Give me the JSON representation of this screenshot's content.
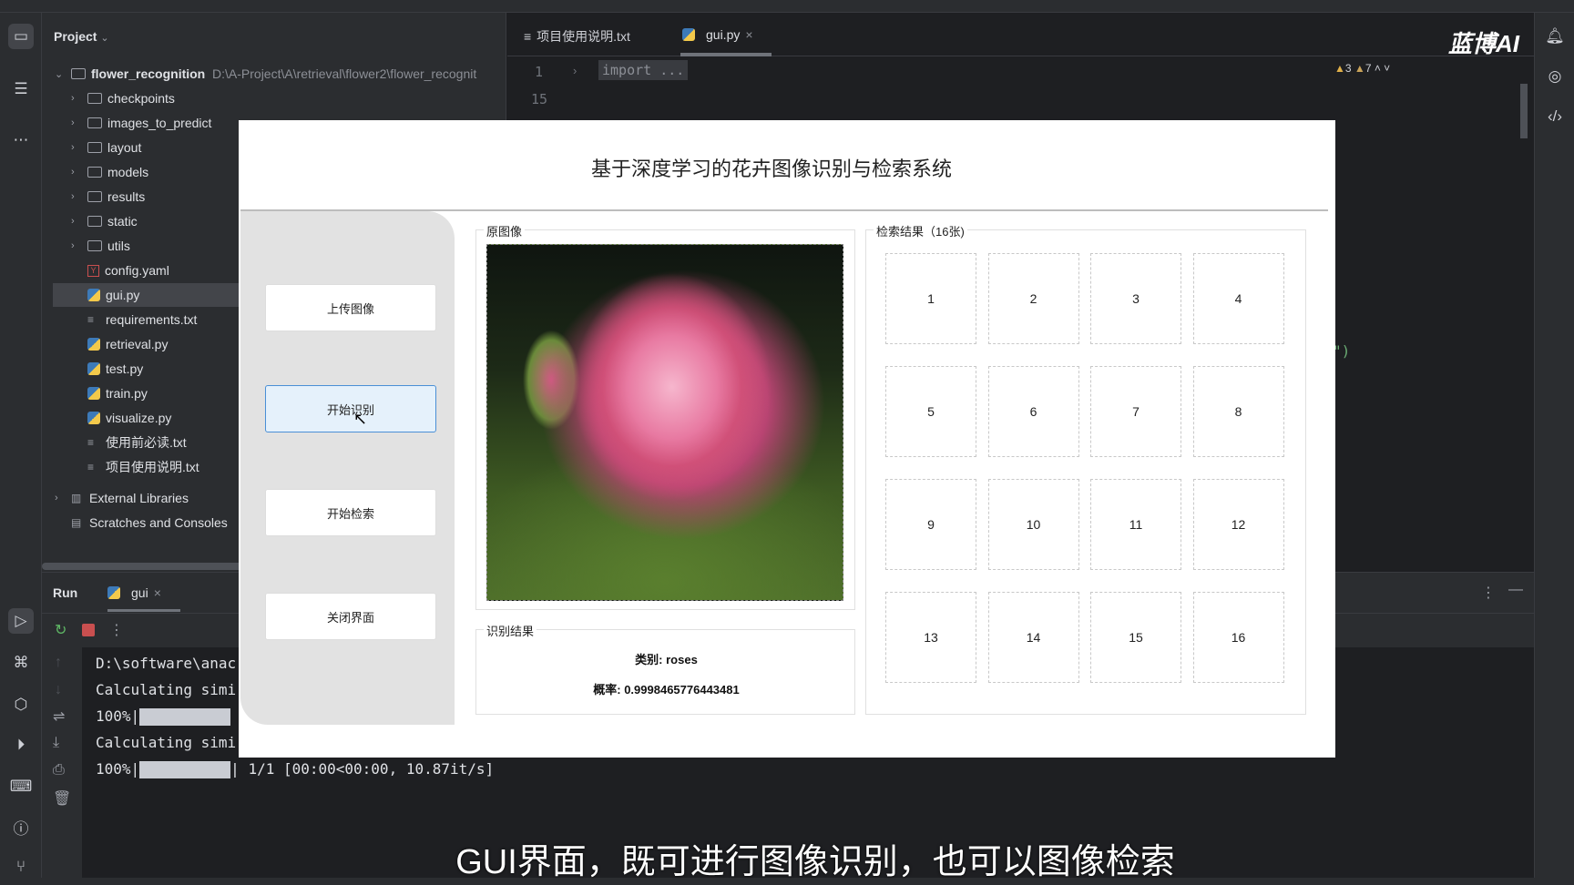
{
  "project": {
    "header": "Project",
    "root_name": "flower_recognition",
    "root_path": "D:\\A-Project\\A\\retrieval\\flower2\\flower_recognit",
    "items": [
      {
        "label": "checkpoints",
        "type": "folder"
      },
      {
        "label": "images_to_predict",
        "type": "folder"
      },
      {
        "label": "layout",
        "type": "folder"
      },
      {
        "label": "models",
        "type": "package"
      },
      {
        "label": "results",
        "type": "folder"
      },
      {
        "label": "static",
        "type": "folder"
      },
      {
        "label": "utils",
        "type": "package"
      },
      {
        "label": "config.yaml",
        "type": "yaml"
      },
      {
        "label": "gui.py",
        "type": "python",
        "selected": true
      },
      {
        "label": "requirements.txt",
        "type": "text"
      },
      {
        "label": "retrieval.py",
        "type": "python"
      },
      {
        "label": "test.py",
        "type": "python"
      },
      {
        "label": "train.py",
        "type": "python"
      },
      {
        "label": "visualize.py",
        "type": "python"
      },
      {
        "label": "使用前必读.txt",
        "type": "text"
      },
      {
        "label": "项目使用说明.txt",
        "type": "text"
      }
    ],
    "external_libraries": "External Libraries",
    "scratches": "Scratches and Consoles"
  },
  "editor": {
    "tabs": [
      {
        "label": "项目使用说明.txt"
      },
      {
        "label": "gui.py",
        "active": true
      }
    ],
    "line_numbers": [
      "1",
      "15"
    ],
    "code_fold": "import ...",
    "code_fragment": "\")",
    "warnings": "3",
    "weak_warnings": "7"
  },
  "watermark": "蓝博AI",
  "run": {
    "title": "Run",
    "tab": "gui",
    "console": [
      "D:\\software\\anac",
      "Calculating simi",
      "100%|",
      "Calculating simi",
      "100%|"
    ],
    "last_line_suffix": "| 1/1 [00:00<00:00, 10.87it/s]"
  },
  "dialog": {
    "title": "基于深度学习的花卉图像识别与检索系统",
    "buttons": {
      "upload": "上传图像",
      "recognize": "开始识别",
      "retrieve": "开始检索",
      "close": "关闭界面"
    },
    "original_label": "原图像",
    "result_label": "识别结果",
    "class_text": "类别: roses",
    "prob_text": "概率: 0.9998465776443481",
    "retrieval_label": "检索结果（16张)",
    "cells": [
      "1",
      "2",
      "3",
      "4",
      "5",
      "6",
      "7",
      "8",
      "9",
      "10",
      "11",
      "12",
      "13",
      "14",
      "15",
      "16"
    ]
  },
  "subtitle": "GUI界面，既可进行图像识别，也可以图像检索"
}
